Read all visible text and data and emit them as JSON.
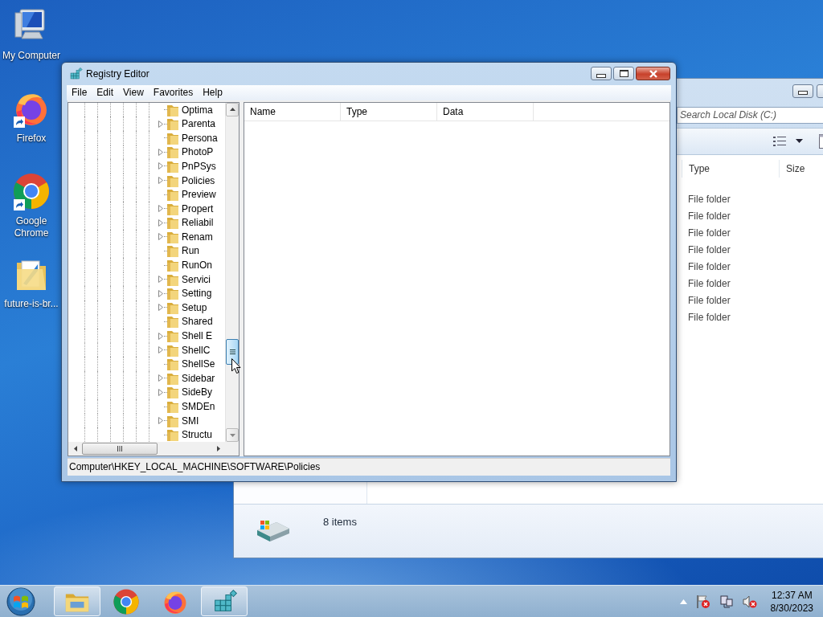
{
  "desktop_icons": [
    {
      "label": "My Computer",
      "kind": "computer",
      "shortcut": false
    },
    {
      "label": "Firefox",
      "kind": "firefox",
      "shortcut": true
    },
    {
      "label": "Google Chrome",
      "kind": "chrome",
      "shortcut": true
    },
    {
      "label": "future-is-br...",
      "kind": "folder",
      "shortcut": false
    }
  ],
  "explorer": {
    "search": {
      "placeholder": "Search Local Disk (C:)"
    },
    "columns": [
      "Type",
      "Size"
    ],
    "rows": [
      {
        "type": "File folder"
      },
      {
        "type": "File folder"
      },
      {
        "type": "File folder"
      },
      {
        "type": "File folder"
      },
      {
        "type": "File folder"
      },
      {
        "type": "File folder"
      },
      {
        "type": "File folder"
      },
      {
        "type": "File folder"
      }
    ],
    "status": "8 items"
  },
  "regedit": {
    "title": "Registry Editor",
    "menu": [
      "File",
      "Edit",
      "View",
      "Favorites",
      "Help"
    ],
    "tree": [
      {
        "label": "Optima",
        "expandable": false
      },
      {
        "label": "Parenta",
        "expandable": true
      },
      {
        "label": "Persona",
        "expandable": false
      },
      {
        "label": "PhotoP",
        "expandable": true
      },
      {
        "label": "PnPSys",
        "expandable": true
      },
      {
        "label": "Policies",
        "expandable": true
      },
      {
        "label": "Preview",
        "expandable": false
      },
      {
        "label": "Propert",
        "expandable": true
      },
      {
        "label": "Reliabil",
        "expandable": true
      },
      {
        "label": "Renam",
        "expandable": true
      },
      {
        "label": "Run",
        "expandable": false
      },
      {
        "label": "RunOn",
        "expandable": false
      },
      {
        "label": "Servici",
        "expandable": true
      },
      {
        "label": "Setting",
        "expandable": true
      },
      {
        "label": "Setup",
        "expandable": true
      },
      {
        "label": "Shared",
        "expandable": false
      },
      {
        "label": "Shell E",
        "expandable": true
      },
      {
        "label": "ShellC",
        "expandable": true
      },
      {
        "label": "ShellSe",
        "expandable": false
      },
      {
        "label": "Sidebar",
        "expandable": true
      },
      {
        "label": "SideBy",
        "expandable": true
      },
      {
        "label": "SMDEn",
        "expandable": false
      },
      {
        "label": "SMI",
        "expandable": true
      },
      {
        "label": "Structu",
        "expandable": false
      }
    ],
    "columns": [
      "Name",
      "Type",
      "Data"
    ],
    "path": "Computer\\HKEY_LOCAL_MACHINE\\SOFTWARE\\Policies"
  },
  "taskbar": {
    "apps": [
      {
        "kind": "explorer",
        "running": true
      },
      {
        "kind": "chrome",
        "running": false
      },
      {
        "kind": "firefox",
        "running": false
      },
      {
        "kind": "regedit",
        "running": true
      }
    ],
    "clock": {
      "time": "12:37 AM",
      "date": "8/30/2023"
    }
  }
}
